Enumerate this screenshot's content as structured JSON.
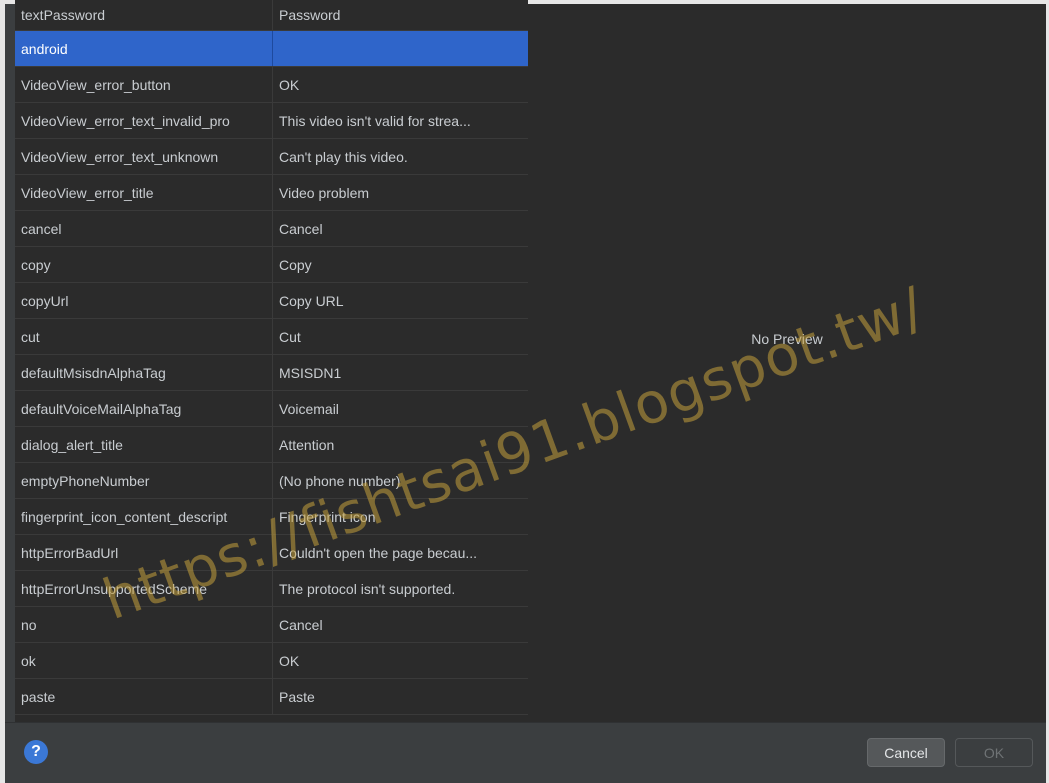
{
  "table": {
    "rows": [
      {
        "key": "textPassword",
        "value": "Password"
      },
      {
        "key": "android",
        "value": ""
      },
      {
        "key": "VideoView_error_button",
        "value": "OK"
      },
      {
        "key": "VideoView_error_text_invalid_pro",
        "value": "This video isn't valid for strea..."
      },
      {
        "key": "VideoView_error_text_unknown",
        "value": "Can't play this video."
      },
      {
        "key": "VideoView_error_title",
        "value": "Video problem"
      },
      {
        "key": "cancel",
        "value": "Cancel"
      },
      {
        "key": "copy",
        "value": "Copy"
      },
      {
        "key": "copyUrl",
        "value": "Copy URL"
      },
      {
        "key": "cut",
        "value": "Cut"
      },
      {
        "key": "defaultMsisdnAlphaTag",
        "value": "MSISDN1"
      },
      {
        "key": "defaultVoiceMailAlphaTag",
        "value": "Voicemail"
      },
      {
        "key": "dialog_alert_title",
        "value": "Attention"
      },
      {
        "key": "emptyPhoneNumber",
        "value": "(No phone number)"
      },
      {
        "key": "fingerprint_icon_content_descript",
        "value": "Fingerprint icon"
      },
      {
        "key": "httpErrorBadUrl",
        "value": "Couldn't open the page becau..."
      },
      {
        "key": "httpErrorUnsupportedScheme",
        "value": "The protocol isn't supported."
      },
      {
        "key": "no",
        "value": "Cancel"
      },
      {
        "key": "ok",
        "value": "OK"
      },
      {
        "key": "paste",
        "value": "Paste"
      }
    ],
    "selected_row": "android"
  },
  "preview": {
    "label": "No Preview"
  },
  "footer": {
    "help_icon": "?",
    "cancel_label": "Cancel",
    "ok_label": "OK"
  },
  "watermark": {
    "text": "https://fishtsai91.blogspot.tw/"
  },
  "colors": {
    "selection": "#2f65ca",
    "panel": "#2b2b2b",
    "chrome": "#3b3e40",
    "text": "#c9cdd1",
    "help": "#3b78d6",
    "watermark": "#c4a03c"
  }
}
